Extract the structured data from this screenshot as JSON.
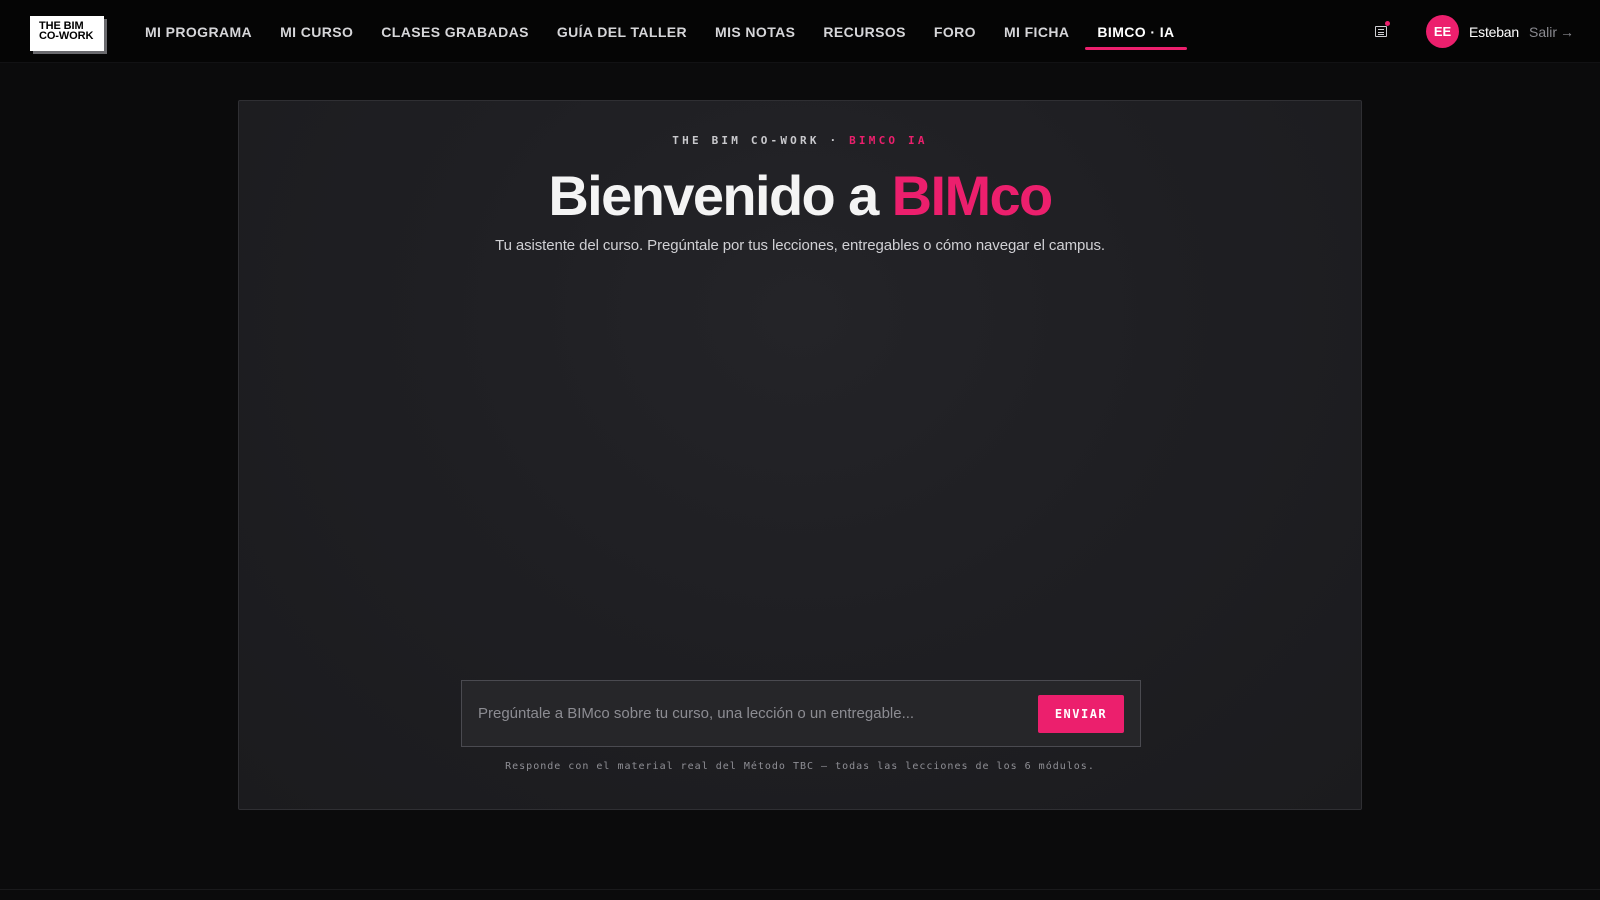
{
  "logo": {
    "line1": "THE BIM",
    "line2": "CO-WORK"
  },
  "nav": {
    "items": [
      {
        "label": "MI PROGRAMA"
      },
      {
        "label": "MI CURSO"
      },
      {
        "label": "CLASES GRABADAS"
      },
      {
        "label": "GUÍA DEL TALLER"
      },
      {
        "label": "MIS NOTAS"
      },
      {
        "label": "RECURSOS"
      },
      {
        "label": "FORO"
      },
      {
        "label": "MI FICHA"
      },
      {
        "label": "BIMCO · IA"
      }
    ],
    "active_index": 8
  },
  "user": {
    "initials": "EE",
    "name": "Esteban",
    "logout_label": "Salir",
    "logout_arrow": "→",
    "notes_icon": "notes-icon",
    "has_notification": true
  },
  "hero": {
    "eyebrow_prefix": "THE BIM CO-WORK · ",
    "eyebrow_accent": "BIMCO IA",
    "title_prefix": "Bienvenido a ",
    "title_brand": "BIMco",
    "subtitle": "Tu asistente del curso. Pregúntale por tus lecciones, entregables o cómo navegar el campus."
  },
  "composer": {
    "placeholder": "Pregúntale a BIMco sobre tu curso, una lección o un entregable...",
    "value": "",
    "send_label": "ENVIAR",
    "disclaimer": "Responde con el material real del Método TBC — todas las lecciones de los 6 módulos."
  },
  "colors": {
    "accent": "#ec1f6d",
    "background": "#0b0b0c",
    "card": "#1f1f23",
    "text": "#f4f4f4"
  }
}
